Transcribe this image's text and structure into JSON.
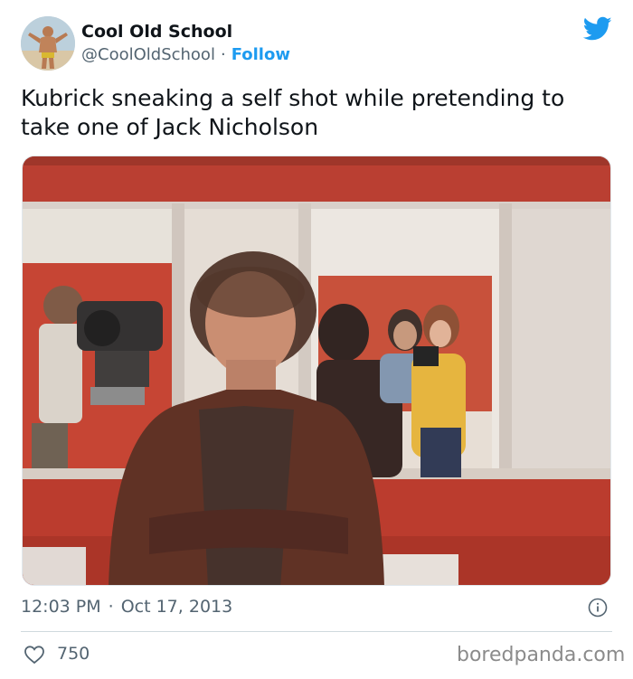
{
  "header": {
    "display_name": "Cool Old School",
    "handle": "@CoolOldSchool",
    "separator": "·",
    "follow_label": "Follow",
    "avatar_icon": "avatar-bodybuilder",
    "brand_icon": "twitter-bird-icon"
  },
  "tweet": {
    "text": "Kubrick sneaking a self shot while pretending to take one of Jack Nicholson"
  },
  "footer": {
    "time": "12:03 PM",
    "separator": "·",
    "date": "Oct 17, 2013",
    "likes": "750",
    "watermark": "boredpanda.com"
  },
  "colors": {
    "accent": "#1d9bf0",
    "text": "#0f1419",
    "muted": "#536471",
    "photo_wall_red": "#c23a2a"
  }
}
